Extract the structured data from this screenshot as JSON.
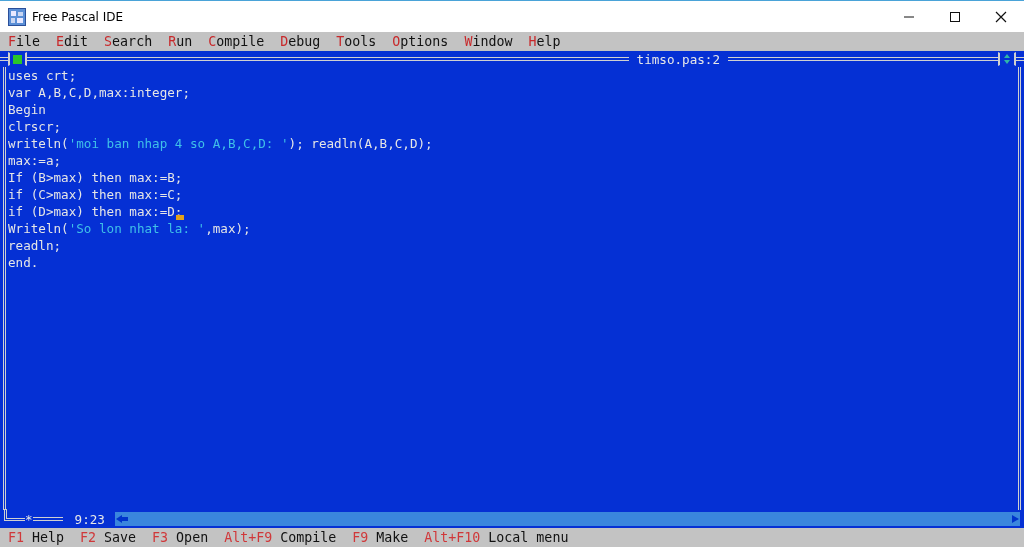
{
  "window": {
    "title": "Free Pascal IDE"
  },
  "menu": [
    {
      "hotkey": "F",
      "rest": "ile"
    },
    {
      "hotkey": "E",
      "rest": "dit"
    },
    {
      "hotkey": "S",
      "rest": "earch"
    },
    {
      "hotkey": "R",
      "rest": "un"
    },
    {
      "hotkey": "C",
      "rest": "ompile"
    },
    {
      "hotkey": "D",
      "rest": "ebug"
    },
    {
      "hotkey": "T",
      "rest": "ools"
    },
    {
      "hotkey": "O",
      "rest": "ptions"
    },
    {
      "hotkey": "W",
      "rest": "indow"
    },
    {
      "hotkey": "H",
      "rest": "elp"
    }
  ],
  "editor": {
    "title": "timso.pas:2",
    "modified_mark": "*",
    "position": "9:23",
    "lines": [
      {
        "segments": [
          {
            "kind": "code",
            "text": "uses crt;"
          }
        ]
      },
      {
        "segments": [
          {
            "kind": "code",
            "text": "var A,B,C,D,max:integer;"
          }
        ]
      },
      {
        "segments": [
          {
            "kind": "code",
            "text": "Begin"
          }
        ]
      },
      {
        "segments": [
          {
            "kind": "code",
            "text": "clrscr;"
          }
        ]
      },
      {
        "segments": [
          {
            "kind": "code",
            "text": "writeln("
          },
          {
            "kind": "string",
            "text": "'moi ban nhap 4 so A,B,C,D: '"
          },
          {
            "kind": "code",
            "text": "); readln(A,B,C,D);"
          }
        ]
      },
      {
        "segments": [
          {
            "kind": "code",
            "text": "max:=a;"
          }
        ]
      },
      {
        "segments": [
          {
            "kind": "code",
            "text": "If (B>max) then max:=B;"
          }
        ]
      },
      {
        "segments": [
          {
            "kind": "code",
            "text": "if (C>max) then max:=C;"
          }
        ]
      },
      {
        "segments": [
          {
            "kind": "code",
            "text": "if (D>max) then max:=D;"
          }
        ],
        "caret": true
      },
      {
        "segments": [
          {
            "kind": "code",
            "text": "Writeln("
          },
          {
            "kind": "string",
            "text": "'So lon nhat la: '"
          },
          {
            "kind": "code",
            "text": ",max);"
          }
        ]
      },
      {
        "segments": [
          {
            "kind": "code",
            "text": "readln;"
          }
        ]
      },
      {
        "segments": [
          {
            "kind": "code",
            "text": "end."
          }
        ]
      }
    ]
  },
  "status_bar": [
    {
      "key": "F1",
      "label": "Help"
    },
    {
      "key": "F2",
      "label": "Save"
    },
    {
      "key": "F3",
      "label": "Open"
    },
    {
      "key": "Alt+F9",
      "label": "Compile"
    },
    {
      "key": "F9",
      "label": "Make"
    },
    {
      "key": "Alt+F10",
      "label": "Local menu"
    }
  ]
}
